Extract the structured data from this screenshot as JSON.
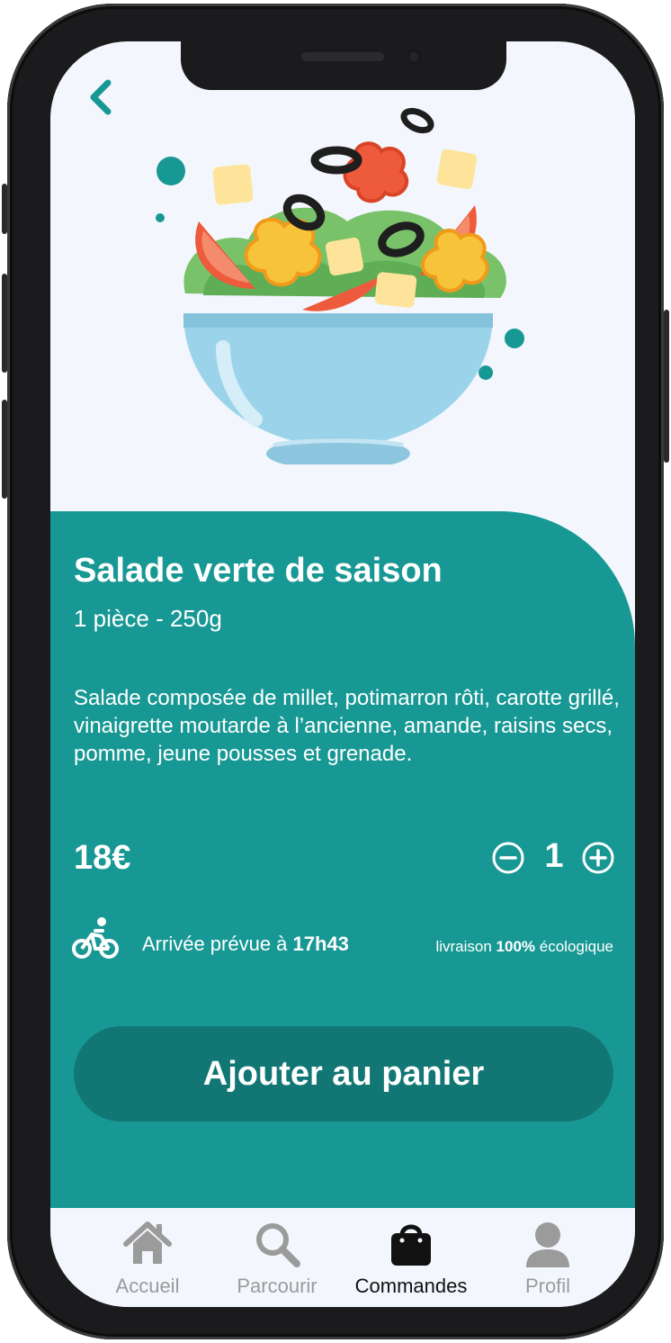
{
  "product": {
    "name": "Salade verte de saison",
    "portion": "1 pièce - 250g",
    "description": "Salade composée de millet, potimarron rôti, carotte grillé, vinaigrette moutarde à l’ancienne, amande, raisins secs, pomme, jeune pousses et grenade.",
    "price": "18€",
    "quantity": "1"
  },
  "delivery": {
    "eta_prefix": "Arrivée prévue à ",
    "eta_time": "17h43",
    "eco_prefix": "livraison ",
    "eco_value": "100%",
    "eco_suffix": " écologique"
  },
  "actions": {
    "add_to_cart": "Ajouter au panier"
  },
  "tabbar": {
    "items": [
      {
        "label": "Accueil",
        "icon": "home-icon"
      },
      {
        "label": "Parcourir",
        "icon": "search-icon"
      },
      {
        "label": "Commandes",
        "icon": "shopping-bag-icon",
        "active": true
      },
      {
        "label": "Profil",
        "icon": "user-icon"
      }
    ]
  },
  "colors": {
    "accent": "#189894",
    "button": "#127774",
    "background": "#f3f6fc",
    "inactive_tab": "#9b9b9b",
    "active_tab": "#111111"
  }
}
